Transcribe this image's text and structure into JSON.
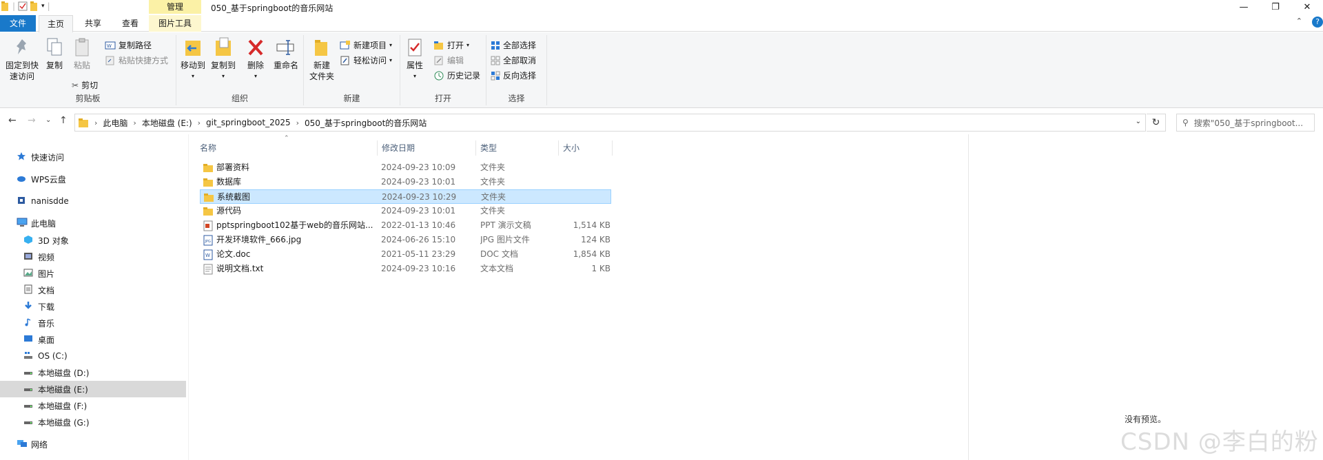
{
  "window": {
    "title": "050_基于springboot的音乐网站",
    "contextual_tab_group": "管理",
    "buttons": {
      "minimize": "—",
      "maximize": "❐",
      "close": "✕"
    }
  },
  "ribbon_tabs": {
    "file": "文件",
    "home": "主页",
    "share": "共享",
    "view": "查看",
    "picture_tools": "图片工具",
    "collapse": "⌃",
    "help": "?"
  },
  "ribbon": {
    "clipboard": {
      "label": "剪贴板",
      "pin": "固定到快\n速访问",
      "pin_line1": "固定到快",
      "pin_line2": "速访问",
      "copy": "复制",
      "paste": "粘贴",
      "copy_path": "复制路径",
      "paste_shortcut": "粘贴快捷方式",
      "cut": "剪切"
    },
    "organize": {
      "label": "组织",
      "move_to": "移动到",
      "copy_to": "复制到",
      "delete": "删除",
      "rename": "重命名"
    },
    "new": {
      "label": "新建",
      "new_folder_line1": "新建",
      "new_folder_line2": "文件夹",
      "new_item": "新建项目",
      "easy_access": "轻松访问"
    },
    "open": {
      "label": "打开",
      "properties": "属性",
      "open": "打开",
      "edit": "编辑",
      "history": "历史记录"
    },
    "select": {
      "label": "选择",
      "select_all": "全部选择",
      "select_none": "全部取消",
      "invert": "反向选择"
    }
  },
  "nav": {
    "back": "←",
    "forward": "→",
    "recent": "⌄",
    "up": "↑",
    "breadcrumb": [
      "此电脑",
      "本地磁盘 (E:)",
      "git_springboot_2025",
      "050_基于springboot的音乐网站"
    ],
    "search_placeholder": "搜索\"050_基于springboot...",
    "refresh": "↻"
  },
  "sidebar": {
    "items": [
      {
        "label": "快速访问",
        "icon": "star-icon"
      },
      {
        "label": "WPS云盘",
        "icon": "cloud-icon"
      },
      {
        "label": "nanisdde",
        "icon": "user-icon"
      },
      {
        "label": "此电脑",
        "icon": "computer-icon"
      },
      {
        "label": "3D 对象",
        "icon": "cube-icon"
      },
      {
        "label": "视频",
        "icon": "video-icon"
      },
      {
        "label": "图片",
        "icon": "picture-icon"
      },
      {
        "label": "文档",
        "icon": "document-icon"
      },
      {
        "label": "下载",
        "icon": "download-icon"
      },
      {
        "label": "音乐",
        "icon": "music-icon"
      },
      {
        "label": "桌面",
        "icon": "desktop-icon"
      },
      {
        "label": "OS (C:)",
        "icon": "os-drive-icon"
      },
      {
        "label": "本地磁盘 (D:)",
        "icon": "drive-icon"
      },
      {
        "label": "本地磁盘 (E:)",
        "icon": "drive-icon"
      },
      {
        "label": "本地磁盘 (F:)",
        "icon": "drive-icon"
      },
      {
        "label": "本地磁盘 (G:)",
        "icon": "drive-icon"
      },
      {
        "label": "网络",
        "icon": "network-icon"
      }
    ]
  },
  "columns": {
    "name": "名称",
    "date": "修改日期",
    "type": "类型",
    "size": "大小"
  },
  "files": [
    {
      "name": "部署资料",
      "date": "2024-09-23 10:09",
      "type": "文件夹",
      "size": "",
      "icon": "folder-icon"
    },
    {
      "name": "数据库",
      "date": "2024-09-23 10:01",
      "type": "文件夹",
      "size": "",
      "icon": "folder-icon"
    },
    {
      "name": "系统截图",
      "date": "2024-09-23 10:29",
      "type": "文件夹",
      "size": "",
      "icon": "folder-icon"
    },
    {
      "name": "源代码",
      "date": "2024-09-23 10:01",
      "type": "文件夹",
      "size": "",
      "icon": "folder-icon"
    },
    {
      "name": "pptspringboot102基于web的音乐网站....",
      "date": "2022-01-13 10:46",
      "type": "PPT 演示文稿",
      "size": "1,514 KB",
      "icon": "ppt-icon"
    },
    {
      "name": "开发环境软件_666.jpg",
      "date": "2024-06-26 15:10",
      "type": "JPG 图片文件",
      "size": "124 KB",
      "icon": "jpg-icon"
    },
    {
      "name": "论文.doc",
      "date": "2021-05-11 23:29",
      "type": "DOC 文档",
      "size": "1,854 KB",
      "icon": "doc-icon"
    },
    {
      "name": "说明文档.txt",
      "date": "2024-09-23 10:16",
      "type": "文本文档",
      "size": "1 KB",
      "icon": "txt-icon"
    }
  ],
  "preview_pane": {
    "empty_text": "没有预览。"
  },
  "watermark": "CSDN @李白的粉"
}
